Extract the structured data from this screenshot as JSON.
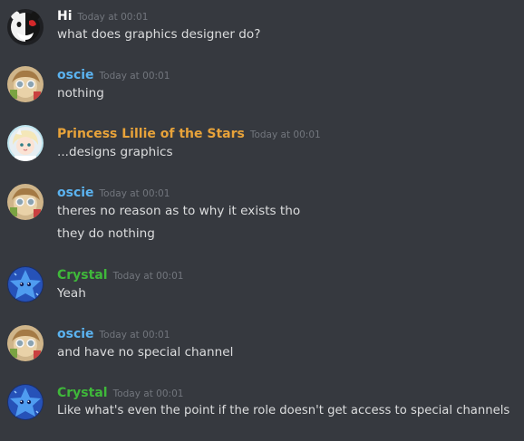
{
  "colors": {
    "background": "#36393f",
    "text": "#dcddde",
    "timestamp": "#72767d",
    "hi": "#ffffff",
    "oscie": "#5bb3f0",
    "lillie": "#e8a33a",
    "crystal": "#3fb83a"
  },
  "messages": [
    {
      "author": "Hi",
      "timestamp": "Today at 00:01",
      "avatar_icon": "monokuma-avatar-icon",
      "lines": [
        "what does graphics designer do?"
      ]
    },
    {
      "author": "oscie",
      "timestamp": "Today at 00:01",
      "avatar_icon": "anime-character-avatar-icon",
      "lines": [
        "nothing"
      ]
    },
    {
      "author": "Princess Lillie of the Stars",
      "timestamp": "Today at 00:01",
      "avatar_icon": "lillie-avatar-icon",
      "lines": [
        "...designs graphics"
      ]
    },
    {
      "author": "oscie",
      "timestamp": "Today at 00:01",
      "avatar_icon": "anime-character-avatar-icon",
      "lines": [
        "theres no reason as to why it exists tho",
        "they do nothing"
      ]
    },
    {
      "author": "Crystal",
      "timestamp": "Today at 00:01",
      "avatar_icon": "blue-star-avatar-icon",
      "lines": [
        "Yeah"
      ]
    },
    {
      "author": "oscie",
      "timestamp": "Today at 00:01",
      "avatar_icon": "anime-character-avatar-icon",
      "lines": [
        "and have no special channel"
      ]
    },
    {
      "author": "Crystal",
      "timestamp": "Today at 00:01",
      "avatar_icon": "blue-star-avatar-icon",
      "lines": [
        "Like what's even the point if the role doesn't get access to special channels"
      ]
    }
  ]
}
